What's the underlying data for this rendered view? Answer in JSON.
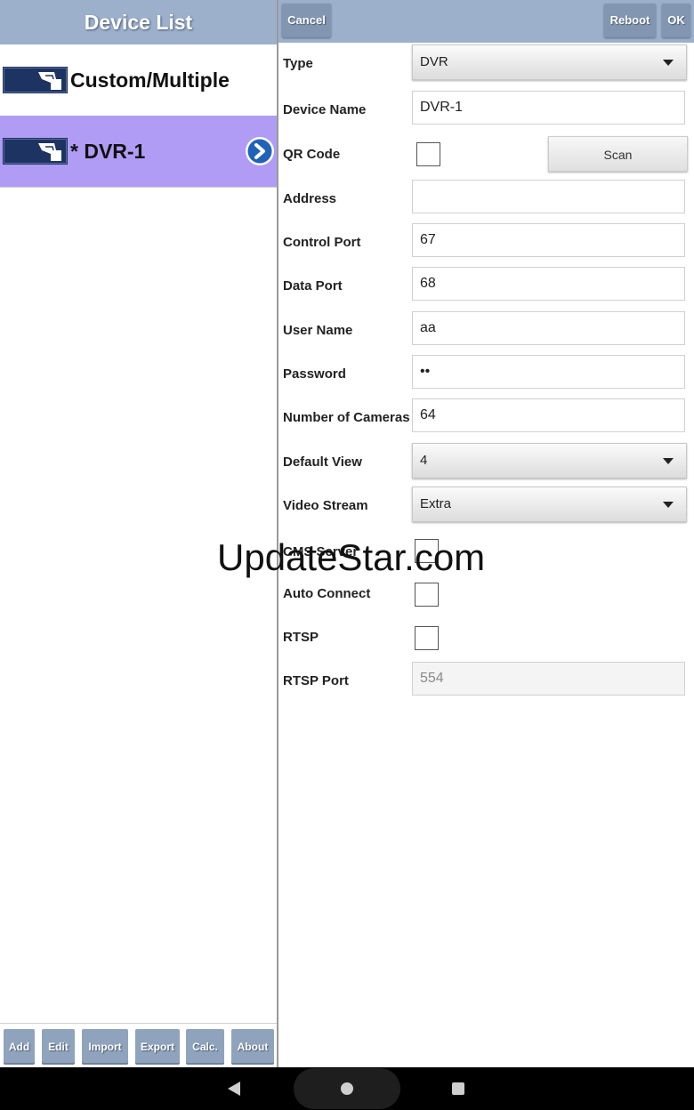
{
  "left_panel": {
    "title": "Device List",
    "devices": [
      {
        "label": "Custom/Multiple"
      },
      {
        "label": "* DVR-1",
        "selected_color": "#b09cf4"
      }
    ],
    "footer_buttons": [
      "Add",
      "Edit",
      "Import",
      "Export",
      "Calc.",
      "About"
    ]
  },
  "right_header": {
    "cancel": "Cancel",
    "reboot": "Reboot",
    "ok": "OK"
  },
  "form": {
    "type": {
      "label": "Type",
      "value": "DVR"
    },
    "device_name": {
      "label": "Device Name",
      "value": "DVR-1"
    },
    "qr_code": {
      "label": "QR Code",
      "button": "Scan"
    },
    "address": {
      "label": "Address",
      "value": ""
    },
    "control_port": {
      "label": "Control Port",
      "value": "67"
    },
    "data_port": {
      "label": "Data Port",
      "value": "68"
    },
    "user_name": {
      "label": "User Name",
      "value": "aa"
    },
    "password": {
      "label": "Password",
      "value": "••"
    },
    "num_cameras": {
      "label": "Number of Cameras",
      "value": "64"
    },
    "default_view": {
      "label": "Default View",
      "value": "4"
    },
    "video_stream": {
      "label": "Video Stream",
      "value": "Extra"
    },
    "cms_server": {
      "label": "CMS Server"
    },
    "auto_connect": {
      "label": "Auto Connect"
    },
    "rtsp": {
      "label": "RTSP"
    },
    "rtsp_port": {
      "label": "RTSP Port",
      "value": "554"
    }
  },
  "watermark": "UpdateStar.com",
  "colors": {
    "header": "#9cb0cc",
    "button": "#8fa3bd",
    "selected": "#b09cf4"
  },
  "icons": [
    "device-icon",
    "chevron-right-icon",
    "dropdown-arrow-icon",
    "nav-back-icon",
    "nav-home-icon",
    "nav-recents-icon"
  ]
}
